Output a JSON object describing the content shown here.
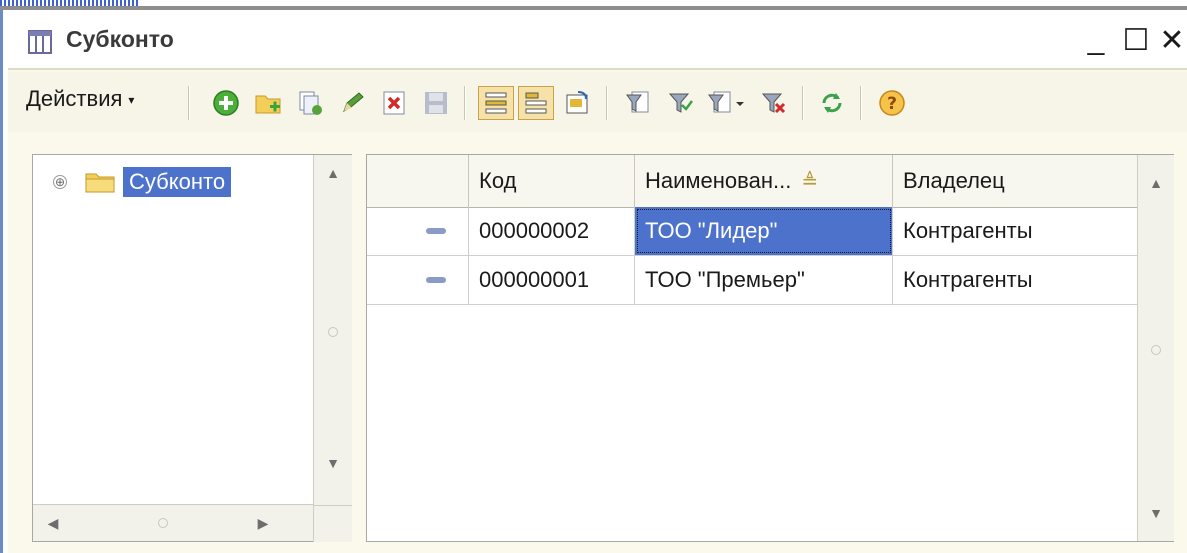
{
  "window": {
    "title": "Субконто",
    "min_symbol": "_",
    "max_symbol": "☐",
    "close_symbol": "✕"
  },
  "toolbar": {
    "actions_label": "Действия",
    "actions_caret": "▾",
    "buttons": [
      {
        "name": "add-icon",
        "color": "#4caf3a"
      },
      {
        "name": "add-folder-icon",
        "color": "#e2b42c"
      },
      {
        "name": "copy-icon",
        "color": "#55a33a"
      },
      {
        "name": "edit-icon",
        "color": "#5a9e3a"
      },
      {
        "name": "delete-icon",
        "color": "#d22a2a"
      },
      {
        "name": "save-disabled-icon",
        "color": "#b8bccb"
      },
      {
        "name": "hierarchy-list-icon",
        "color": "#e1b734"
      },
      {
        "name": "hierarchy-tree-icon",
        "color": "#e1b734"
      },
      {
        "name": "move-to-group-icon",
        "color": "#e1b734"
      },
      {
        "name": "filter-icon",
        "color": "#7a8aa5"
      },
      {
        "name": "filter-by-value-icon",
        "color": "#7a8aa5"
      },
      {
        "name": "filter-history-icon",
        "color": "#7a8aa5"
      },
      {
        "name": "clear-filter-icon",
        "color": "#d22a2a"
      },
      {
        "name": "refresh-icon",
        "color": "#3aa34a"
      },
      {
        "name": "help-icon",
        "color": "#e8a12c"
      }
    ],
    "help_glyph": "?"
  },
  "tree": {
    "expander": "⊕",
    "root_label": "Субконто",
    "up_arrow": "▲",
    "down_arrow": "▼",
    "left_arrow": "◀",
    "right_arrow": "▶"
  },
  "grid": {
    "columns": [
      "Код",
      "Наименован...",
      "Владелец"
    ],
    "sort_indicator": "≜",
    "rows": [
      {
        "code": "000000002",
        "name": "ТОО \"Лидер\"",
        "owner": "Контрагенты"
      },
      {
        "code": "000000001",
        "name": "ТОО \"Премьер\"",
        "owner": "Контрагенты"
      }
    ],
    "up_arrow": "▲",
    "down_arrow": "▼"
  },
  "colors": {
    "selection": "#4c72cb",
    "window_bg": "#faf9ec"
  }
}
